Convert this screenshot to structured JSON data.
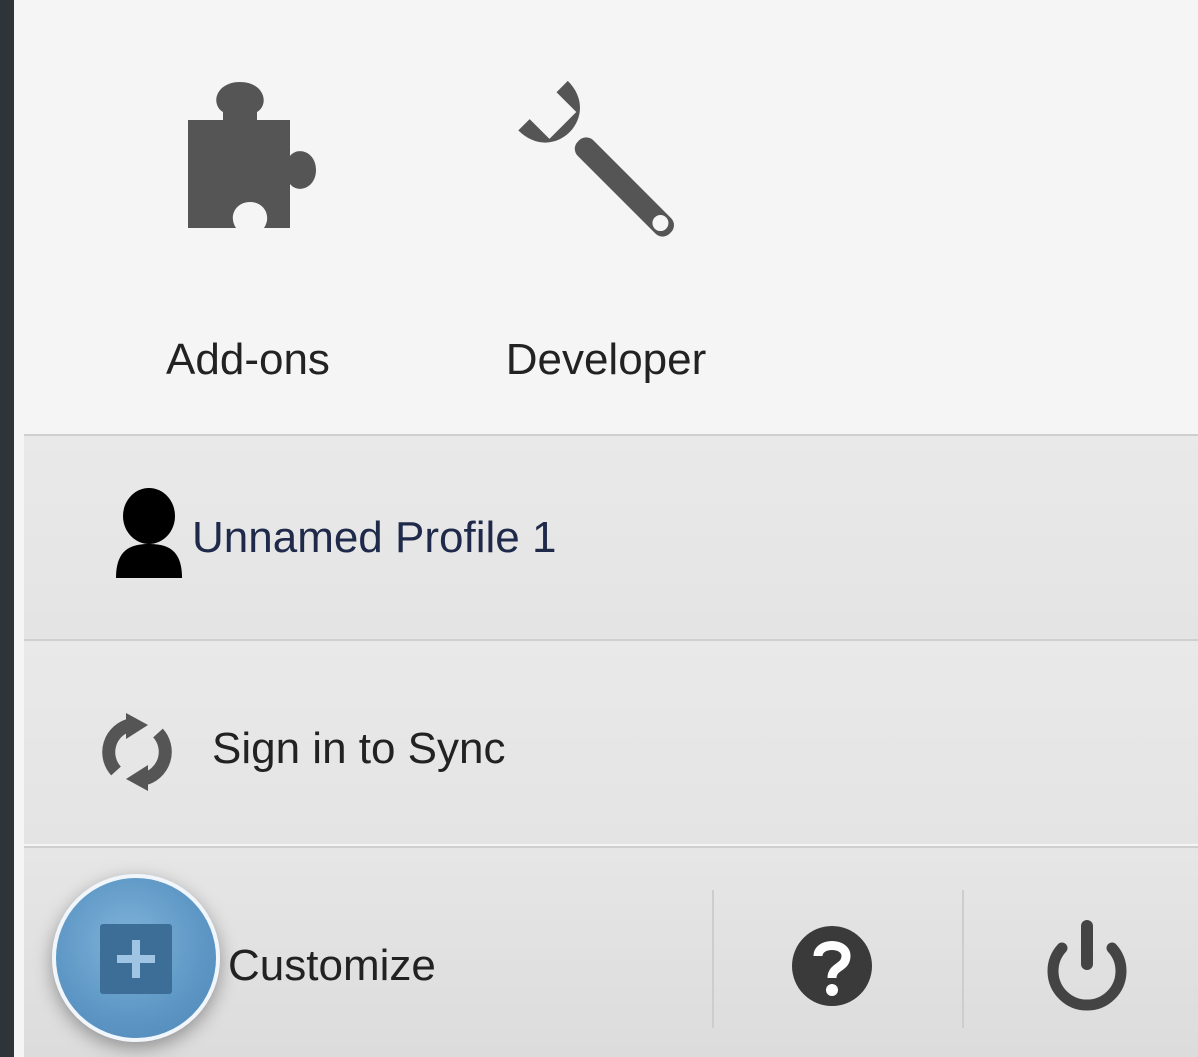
{
  "menu": {
    "grid_items": [
      {
        "label": "Add-ons",
        "icon": "puzzle-piece-icon"
      },
      {
        "label": "Developer",
        "icon": "wrench-icon"
      }
    ],
    "profile": {
      "label": "Unnamed Profile 1",
      "icon": "avatar-icon"
    },
    "sync": {
      "label": "Sign in to Sync",
      "icon": "sync-icon"
    },
    "footer": {
      "customize_label": "Customize",
      "customize_icon": "plus-icon",
      "help_icon": "help-icon",
      "quit_icon": "power-icon"
    }
  },
  "colors": {
    "panel_background": "#f5f5f5",
    "icon_gray": "#555555",
    "highlight_blue": "#5f98c6"
  }
}
